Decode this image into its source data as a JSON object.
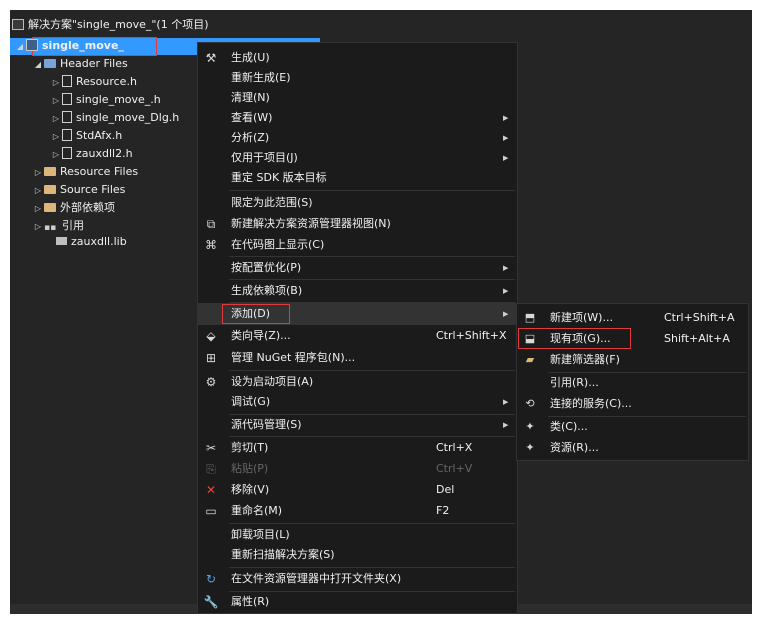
{
  "solution_explorer": {
    "solution_label": "解决方案\"single_move_\"(1 个项目)",
    "project_label": "single_move_",
    "items": [
      {
        "label": "Header Files",
        "icon": "filter-icon"
      },
      {
        "label": "Resource.h",
        "icon": "header-file-icon"
      },
      {
        "label": "single_move_.h",
        "icon": "header-file-icon"
      },
      {
        "label": "single_move_Dlg.h",
        "icon": "header-file-icon"
      },
      {
        "label": "StdAfx.h",
        "icon": "header-file-icon"
      },
      {
        "label": "zauxdll2.h",
        "icon": "header-file-icon"
      },
      {
        "label": "Resource Files",
        "icon": "folder-icon"
      },
      {
        "label": "Source Files",
        "icon": "folder-icon"
      },
      {
        "label": "外部依赖项",
        "icon": "external-deps-icon"
      },
      {
        "label": "引用",
        "icon": "references-icon"
      },
      {
        "label": "zauxdll.lib",
        "icon": "lib-file-icon"
      }
    ]
  },
  "context_menu": {
    "items": [
      {
        "label": "生成(U)",
        "icon": "build-icon"
      },
      {
        "label": "重新生成(E)"
      },
      {
        "label": "清理(N)"
      },
      {
        "label": "查看(W)",
        "submenu": true
      },
      {
        "label": "分析(Z)",
        "submenu": true
      },
      {
        "label": "仅用于项目(J)",
        "submenu": true
      },
      {
        "label": "重定 SDK 版本目标"
      },
      {
        "label": "限定为此范围(S)"
      },
      {
        "label": "新建解决方案资源管理器视图(N)",
        "icon": "new-view-icon"
      },
      {
        "label": "在代码图上显示(C)",
        "icon": "code-map-icon"
      },
      {
        "label": "按配置优化(P)",
        "submenu": true
      },
      {
        "label": "生成依赖项(B)",
        "submenu": true
      },
      {
        "label": "添加(D)",
        "submenu": true
      },
      {
        "label": "类向导(Z)...",
        "shortcut": "Ctrl+Shift+X",
        "icon": "class-wizard-icon"
      },
      {
        "label": "管理 NuGet 程序包(N)...",
        "icon": "nuget-icon"
      },
      {
        "label": "设为启动项目(A)",
        "icon": "gear-icon"
      },
      {
        "label": "调试(G)",
        "submenu": true
      },
      {
        "label": "源代码管理(S)",
        "submenu": true
      },
      {
        "label": "剪切(T)",
        "shortcut": "Ctrl+X",
        "icon": "scissors-icon"
      },
      {
        "label": "粘贴(P)",
        "shortcut": "Ctrl+V",
        "icon": "paste-icon",
        "disabled": true
      },
      {
        "label": "移除(V)",
        "shortcut": "Del",
        "icon": "remove-icon"
      },
      {
        "label": "重命名(M)",
        "shortcut": "F2",
        "icon": "rename-icon"
      },
      {
        "label": "卸载项目(L)"
      },
      {
        "label": "重新扫描解决方案(S)"
      },
      {
        "label": "在文件资源管理器中打开文件夹(X)",
        "icon": "refresh-icon"
      },
      {
        "label": "属性(R)",
        "icon": "wrench-icon"
      }
    ]
  },
  "add_submenu": {
    "items": [
      {
        "label": "新建项(W)...",
        "shortcut": "Ctrl+Shift+A",
        "icon": "new-item-icon"
      },
      {
        "label": "现有项(G)...",
        "shortcut": "Shift+Alt+A",
        "icon": "existing-item-icon"
      },
      {
        "label": "新建筛选器(F)",
        "icon": "new-filter-icon"
      },
      {
        "label": "引用(R)..."
      },
      {
        "label": "连接的服务(C)...",
        "icon": "connected-service-icon"
      },
      {
        "label": "类(C)...",
        "icon": "class-icon"
      },
      {
        "label": "资源(R)...",
        "icon": "resource-icon"
      }
    ]
  },
  "colors": {
    "background": "#252526",
    "selection": "#3399ff",
    "menu_background": "#1b1b1c",
    "highlight_box": "#e23b3b",
    "disabled_text": "#656565"
  }
}
